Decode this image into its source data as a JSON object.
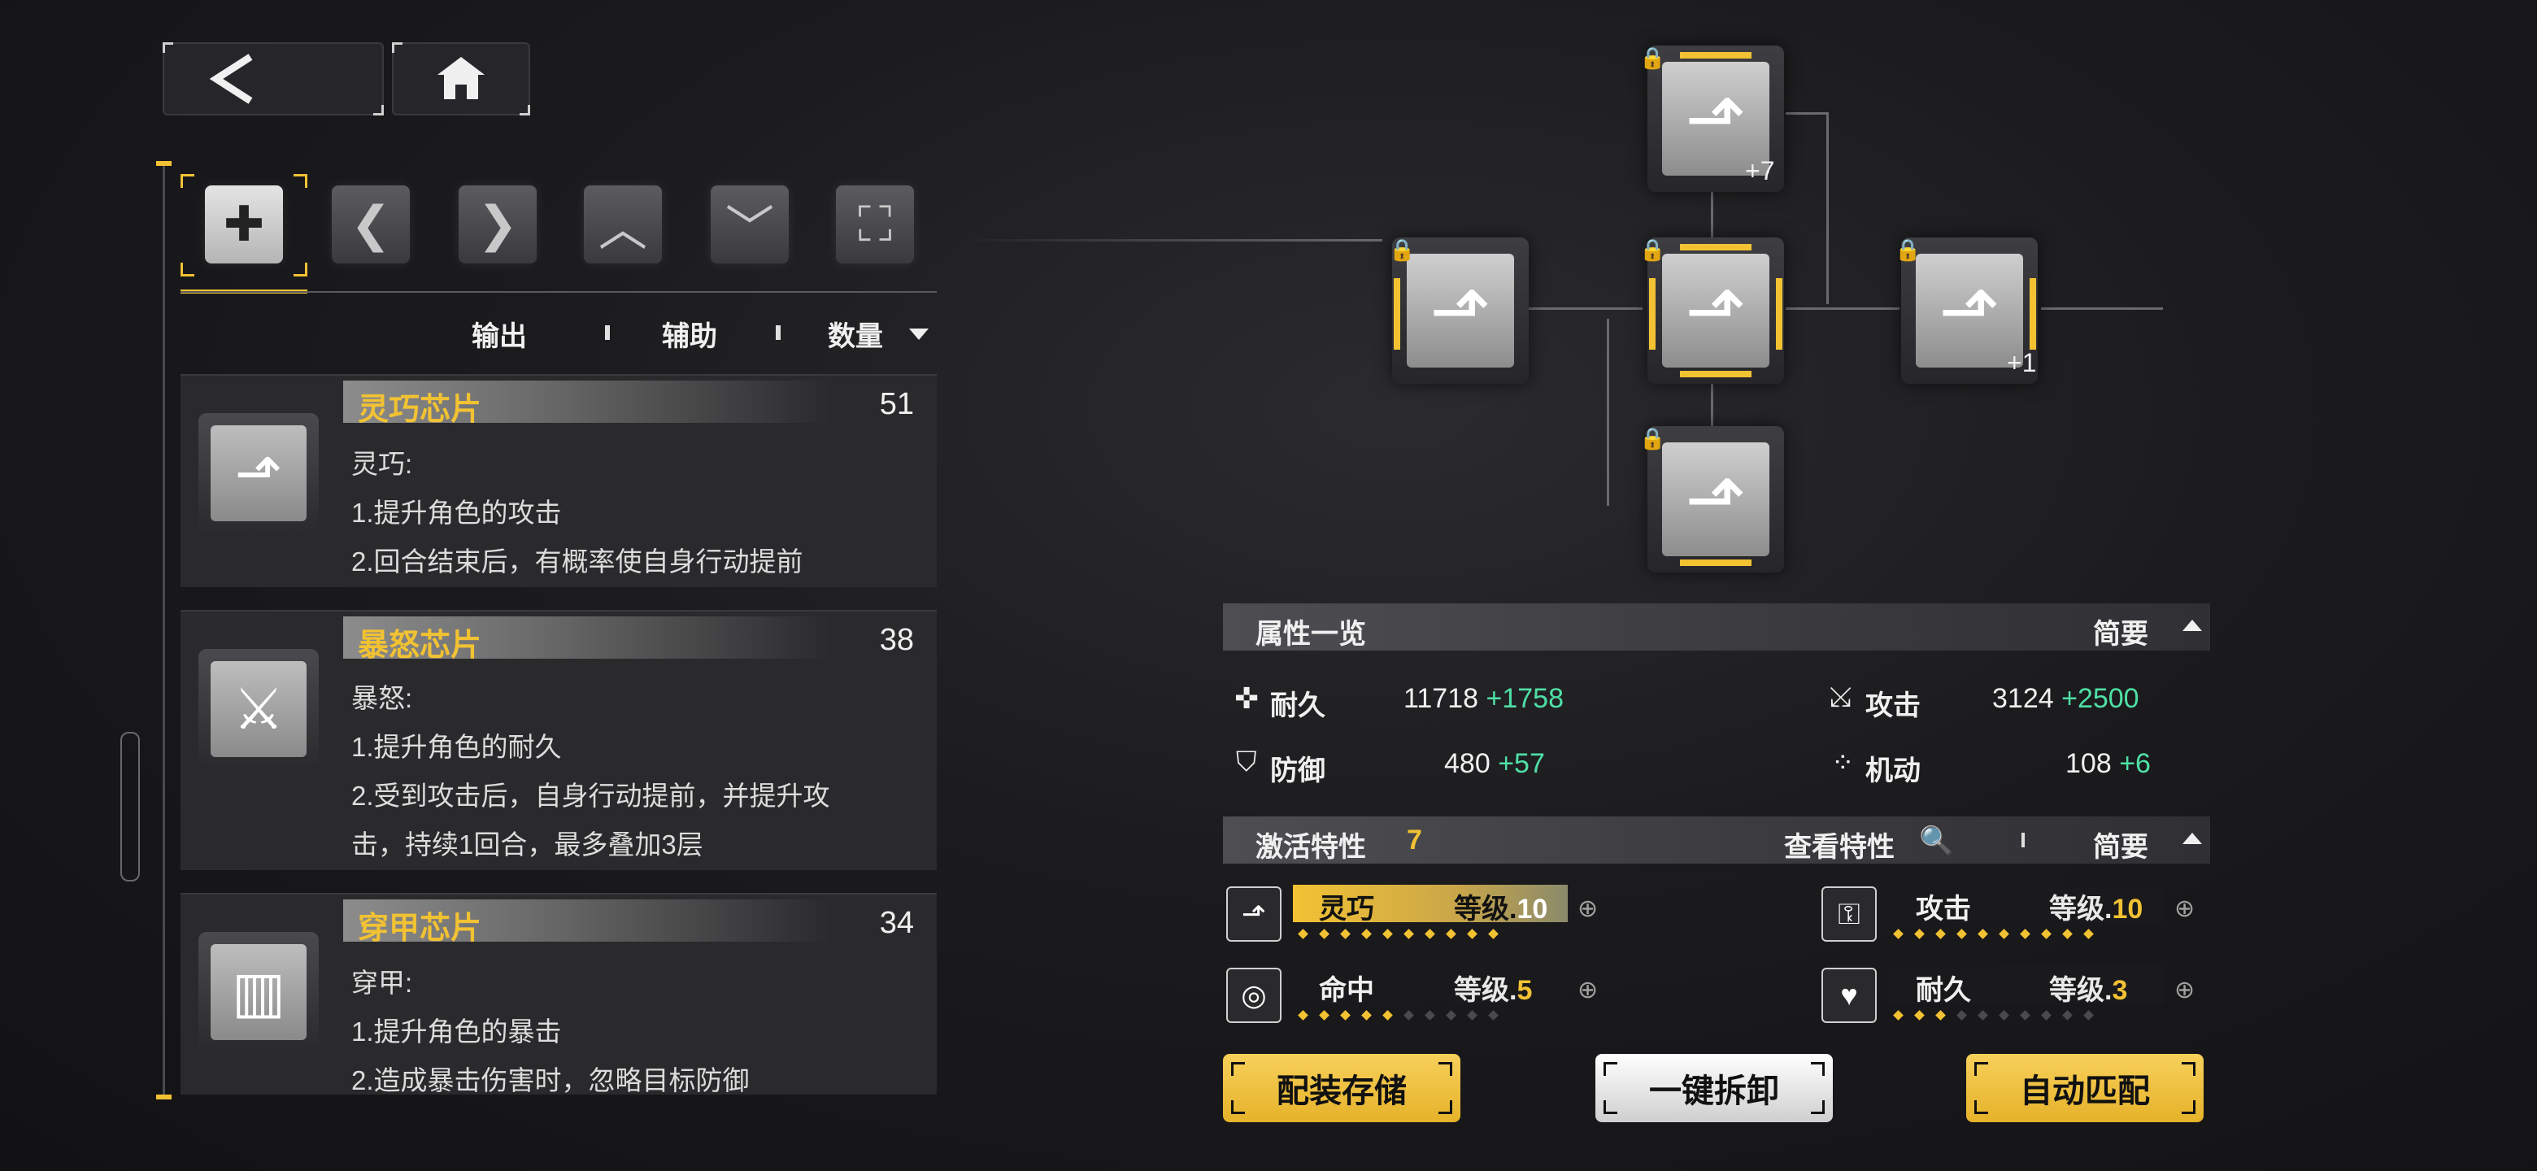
{
  "nav": {
    "back_icon": "chevron-left-icon",
    "home_icon": "home-icon"
  },
  "filter_tabs": [
    {
      "icon": "all-chips-icon",
      "glyph": "✚",
      "active": true
    },
    {
      "icon": "left-bracket-icon",
      "glyph": "❮",
      "active": false
    },
    {
      "icon": "right-bracket-icon",
      "glyph": "❯",
      "active": false
    },
    {
      "icon": "up-chevron-icon",
      "glyph": "︿",
      "active": false
    },
    {
      "icon": "down-chevron-icon",
      "glyph": "﹀",
      "active": false
    },
    {
      "icon": "frame-icon",
      "glyph": "⛶",
      "active": false
    }
  ],
  "sort": {
    "output": "输出",
    "support": "辅助",
    "quantity": "数量"
  },
  "chips": [
    {
      "title": "灵巧芯片",
      "count": "51",
      "icon": "dexterity-chip-icon",
      "lines": [
        "灵巧:",
        "1.提升角色的攻击",
        "2.回合结束后，有概率使自身行动提前"
      ]
    },
    {
      "title": "暴怒芯片",
      "count": "38",
      "icon": "rage-chip-icon",
      "lines": [
        "暴怒:",
        "1.提升角色的耐久",
        "2.受到攻击后，自身行动提前，并提升攻",
        "击，持续1回合，最多叠加3层"
      ]
    },
    {
      "title": "穿甲芯片",
      "count": "34",
      "icon": "pierce-chip-icon",
      "lines": [
        "穿甲:",
        "1.提升角色的暴击",
        "2.造成暴击伤害时，忽略目标防御"
      ]
    }
  ],
  "grid": {
    "slots": [
      {
        "name": "slot-top",
        "plus": "+7"
      },
      {
        "name": "slot-left",
        "plus": ""
      },
      {
        "name": "slot-center",
        "plus": ""
      },
      {
        "name": "slot-right",
        "plus": "+1"
      },
      {
        "name": "slot-bottom",
        "plus": ""
      }
    ]
  },
  "attributes": {
    "header": "属性一览",
    "mode": "简要",
    "stats": [
      {
        "label": "耐久",
        "base": "11718",
        "bonus": "+1758",
        "icon": "durability-icon"
      },
      {
        "label": "攻击",
        "base": "3124",
        "bonus": "+2500",
        "icon": "attack-icon"
      },
      {
        "label": "防御",
        "base": "480",
        "bonus": "+57",
        "icon": "defense-icon"
      },
      {
        "label": "机动",
        "base": "108",
        "bonus": "+6",
        "icon": "mobility-icon"
      }
    ]
  },
  "traits": {
    "header": "激活特性",
    "count": "7",
    "view": "查看特性",
    "mode": "简要",
    "level_prefix": "等级.",
    "items": [
      {
        "name": "灵巧",
        "level": "10",
        "dots_on": 10,
        "dots_total": 10,
        "icon": "dexterity-trait-icon",
        "active": true
      },
      {
        "name": "攻击",
        "level": "10",
        "dots_on": 10,
        "dots_total": 10,
        "icon": "attack-trait-icon",
        "active": false
      },
      {
        "name": "命中",
        "level": "5",
        "dots_on": 5,
        "dots_total": 10,
        "icon": "accuracy-trait-icon",
        "active": false
      },
      {
        "name": "耐久",
        "level": "3",
        "dots_on": 3,
        "dots_total": 10,
        "icon": "durability-trait-icon",
        "active": false
      }
    ]
  },
  "actions": {
    "save": "配装存储",
    "unequip": "一键拆卸",
    "auto": "自动匹配"
  },
  "colors": {
    "accent": "#f2c233",
    "bonus_green": "#4fe0a6"
  }
}
